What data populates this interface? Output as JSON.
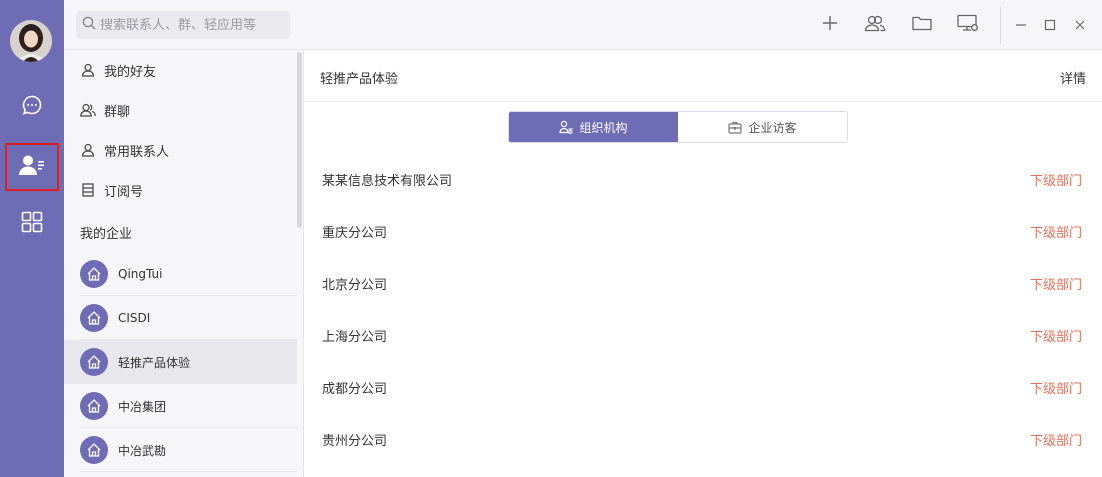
{
  "search": {
    "placeholder": "搜索联系人、群、轻应用等"
  },
  "rail": {
    "icons": [
      "avatar",
      "chat-icon",
      "contacts-icon",
      "apps-icon"
    ]
  },
  "toolbar": {
    "icons": [
      "plus-icon",
      "group-icon",
      "folder-icon",
      "screen-share-icon"
    ]
  },
  "window": {
    "minimize": "—",
    "maximize": "☐",
    "close": "×"
  },
  "sidebar": {
    "nav": [
      {
        "label": "我的好友",
        "icon": "person-icon"
      },
      {
        "label": "群聊",
        "icon": "people-icon"
      },
      {
        "label": "常用联系人",
        "icon": "person-icon"
      },
      {
        "label": "订阅号",
        "icon": "book-icon"
      }
    ],
    "section_label": "我的企业",
    "orgs": [
      {
        "name": "QingTui"
      },
      {
        "name": "CISDI"
      },
      {
        "name": "轻推产品体验"
      },
      {
        "name": "中冶集团"
      },
      {
        "name": "中冶武勘"
      }
    ]
  },
  "main": {
    "title": "轻推产品体验",
    "detail": "详情",
    "tabs": [
      {
        "label": "组织机构"
      },
      {
        "label": "企业访客"
      }
    ],
    "depts": [
      {
        "name": "某某信息技术有限公司",
        "link": "下级部门"
      },
      {
        "name": "重庆分公司",
        "link": "下级部门"
      },
      {
        "name": "北京分公司",
        "link": "下级部门"
      },
      {
        "name": "上海分公司",
        "link": "下级部门"
      },
      {
        "name": "成都分公司",
        "link": "下级部门"
      },
      {
        "name": "贵州分公司",
        "link": "下级部门"
      }
    ]
  },
  "colors": {
    "accent": "#6e6cb4",
    "link": "#e8705a",
    "highlight_border": "#e02020"
  }
}
